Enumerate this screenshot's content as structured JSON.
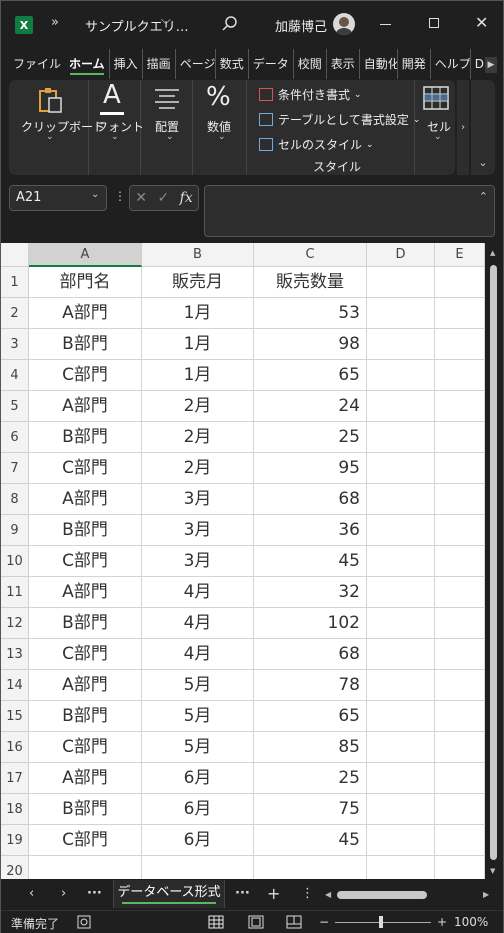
{
  "titlebar": {
    "app_icon": "X",
    "more": "»",
    "title": "サンプルクエリ…",
    "chevron": "⌵",
    "user": "加藤博己",
    "minimize_label": "",
    "maximize_label": "",
    "close": "✕"
  },
  "tabs": [
    {
      "label": "ファイル"
    },
    {
      "label": "ホーム"
    },
    {
      "label": "挿入"
    },
    {
      "label": "描画"
    },
    {
      "label": "ページ"
    },
    {
      "label": "数式"
    },
    {
      "label": "データ"
    },
    {
      "label": "校閲"
    },
    {
      "label": "表示"
    },
    {
      "label": "自動化"
    },
    {
      "label": "開発"
    },
    {
      "label": "ヘルプ"
    },
    {
      "label": "D"
    }
  ],
  "ribbon": {
    "clipboard": "クリップボード",
    "font": "フォント",
    "alignment": "配置",
    "number": "数値",
    "number_symbol": "%",
    "font_symbol": "A",
    "cond_format": "条件付き書式",
    "table_format": "テーブルとして書式設定",
    "cell_style": "セルのスタイル",
    "style_group": "スタイル",
    "cells": "セル",
    "dropdown": "⌄",
    "side_arrow": "›",
    "collapse": "⌄"
  },
  "formula_bar": {
    "name_box": "A21",
    "name_box_chevron": "⌄",
    "dots": "⋮",
    "cancel": "✕",
    "enter": "✓",
    "fx": "fx",
    "formula": "",
    "expand": "⌃"
  },
  "grid": {
    "columns": [
      "A",
      "B",
      "C",
      "D",
      "E"
    ],
    "header_row": {
      "row_num": "1",
      "a": "部門名",
      "b": "販売月",
      "c": "販売数量"
    },
    "rows": [
      {
        "n": "2",
        "a": "A部門",
        "b": "1月",
        "c": "53"
      },
      {
        "n": "3",
        "a": "B部門",
        "b": "1月",
        "c": "98"
      },
      {
        "n": "4",
        "a": "C部門",
        "b": "1月",
        "c": "65"
      },
      {
        "n": "5",
        "a": "A部門",
        "b": "2月",
        "c": "24"
      },
      {
        "n": "6",
        "a": "B部門",
        "b": "2月",
        "c": "25"
      },
      {
        "n": "7",
        "a": "C部門",
        "b": "2月",
        "c": "95"
      },
      {
        "n": "8",
        "a": "A部門",
        "b": "3月",
        "c": "68"
      },
      {
        "n": "9",
        "a": "B部門",
        "b": "3月",
        "c": "36"
      },
      {
        "n": "10",
        "a": "C部門",
        "b": "3月",
        "c": "45"
      },
      {
        "n": "11",
        "a": "A部門",
        "b": "4月",
        "c": "32"
      },
      {
        "n": "12",
        "a": "B部門",
        "b": "4月",
        "c": "102"
      },
      {
        "n": "13",
        "a": "C部門",
        "b": "4月",
        "c": "68"
      },
      {
        "n": "14",
        "a": "A部門",
        "b": "5月",
        "c": "78"
      },
      {
        "n": "15",
        "a": "B部門",
        "b": "5月",
        "c": "65"
      },
      {
        "n": "16",
        "a": "C部門",
        "b": "5月",
        "c": "85"
      },
      {
        "n": "17",
        "a": "A部門",
        "b": "6月",
        "c": "25"
      },
      {
        "n": "18",
        "a": "B部門",
        "b": "6月",
        "c": "75"
      },
      {
        "n": "19",
        "a": "C部門",
        "b": "6月",
        "c": "45"
      },
      {
        "n": "20",
        "a": "",
        "b": "",
        "c": ""
      }
    ]
  },
  "sheetbar": {
    "prev": "‹",
    "next": "›",
    "more_left": "···",
    "sheet_name": "データベース形式",
    "more_right": "···",
    "add": "+",
    "options": "⋮"
  },
  "statusbar": {
    "ready": "準備完了",
    "zoom_minus": "−",
    "zoom_plus": "+",
    "zoom": "100%"
  },
  "colors": {
    "accent": "#107c41",
    "tab_underline": "#5cb85c"
  }
}
